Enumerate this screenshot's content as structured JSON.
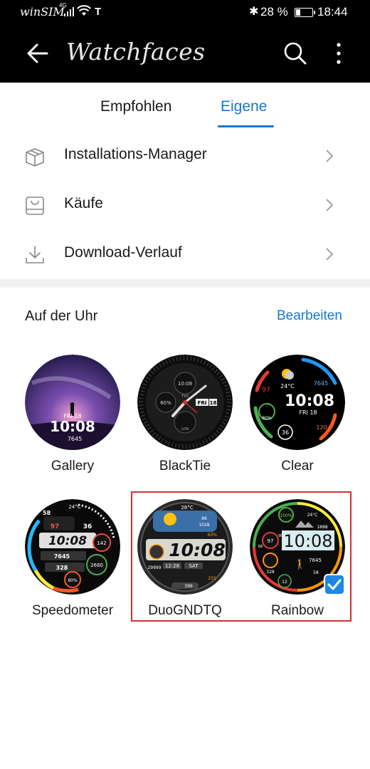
{
  "status_bar": {
    "carrier": "winSIM",
    "network": "4G",
    "operator_glyph": "T",
    "battery_percent": "28 %",
    "battery_level": 0.28,
    "time": "18:44"
  },
  "header": {
    "title": "Watchfaces",
    "icons": [
      "back-arrow-icon",
      "search-icon",
      "more-vert-icon"
    ]
  },
  "tabs": [
    {
      "label": "Empfohlen",
      "active": false
    },
    {
      "label": "Eigene",
      "active": true
    }
  ],
  "menu": [
    {
      "label": "Installations-Manager",
      "icon": "package-box-icon"
    },
    {
      "label": "Käufe",
      "icon": "shopping-bag-icon"
    },
    {
      "label": "Download-Verlauf",
      "icon": "download-icon"
    }
  ],
  "section": {
    "title": "Auf der Uhr",
    "action": "Bearbeiten"
  },
  "watchfaces": [
    {
      "name": "Gallery",
      "date": "FRI 18",
      "time": "10:08",
      "steps": "7645",
      "selected": false
    },
    {
      "name": "BlackTie",
      "time": "10:08",
      "date": "FRI",
      "day": "18",
      "battery": "60%",
      "city1": "TYO",
      "city2": "LON",
      "selected": false
    },
    {
      "name": "Clear",
      "temp": "24°C",
      "steps": "7645",
      "hr": "97",
      "battery": "80%",
      "time": "10:08",
      "date": "FRI 18",
      "cal": "120",
      "act": "36",
      "selected": false
    },
    {
      "name": "Speedometer",
      "temp": "24°C",
      "hr": "97",
      "stress": "36",
      "time": "10:08",
      "steps": "7645",
      "cal": "328",
      "dist": "2680",
      "kcal": "142",
      "battery": "80%",
      "top": "58",
      "selected": false
    },
    {
      "name": "DuoGNDTQ",
      "temp": "28°C",
      "humidity": "88",
      "pressure": "1028",
      "battery": "60%",
      "time": "10:08",
      "steps": "29999",
      "date": "12:28",
      "day": "SAT",
      "cal": "399",
      "extra": "255",
      "selected": true
    },
    {
      "name": "Rainbow",
      "temp": "24°C",
      "battery": "100%",
      "altitude": "1888",
      "hr": "97",
      "hr_max": "98",
      "hr_min": "68",
      "time": "10:08",
      "steps": "7645",
      "cal": "328",
      "stand": "12",
      "sleep": "58",
      "selected": true
    }
  ],
  "colors": {
    "accent": "#1677d2",
    "selection_border": "#d32f2f",
    "check_badge": "#1e88e5"
  }
}
